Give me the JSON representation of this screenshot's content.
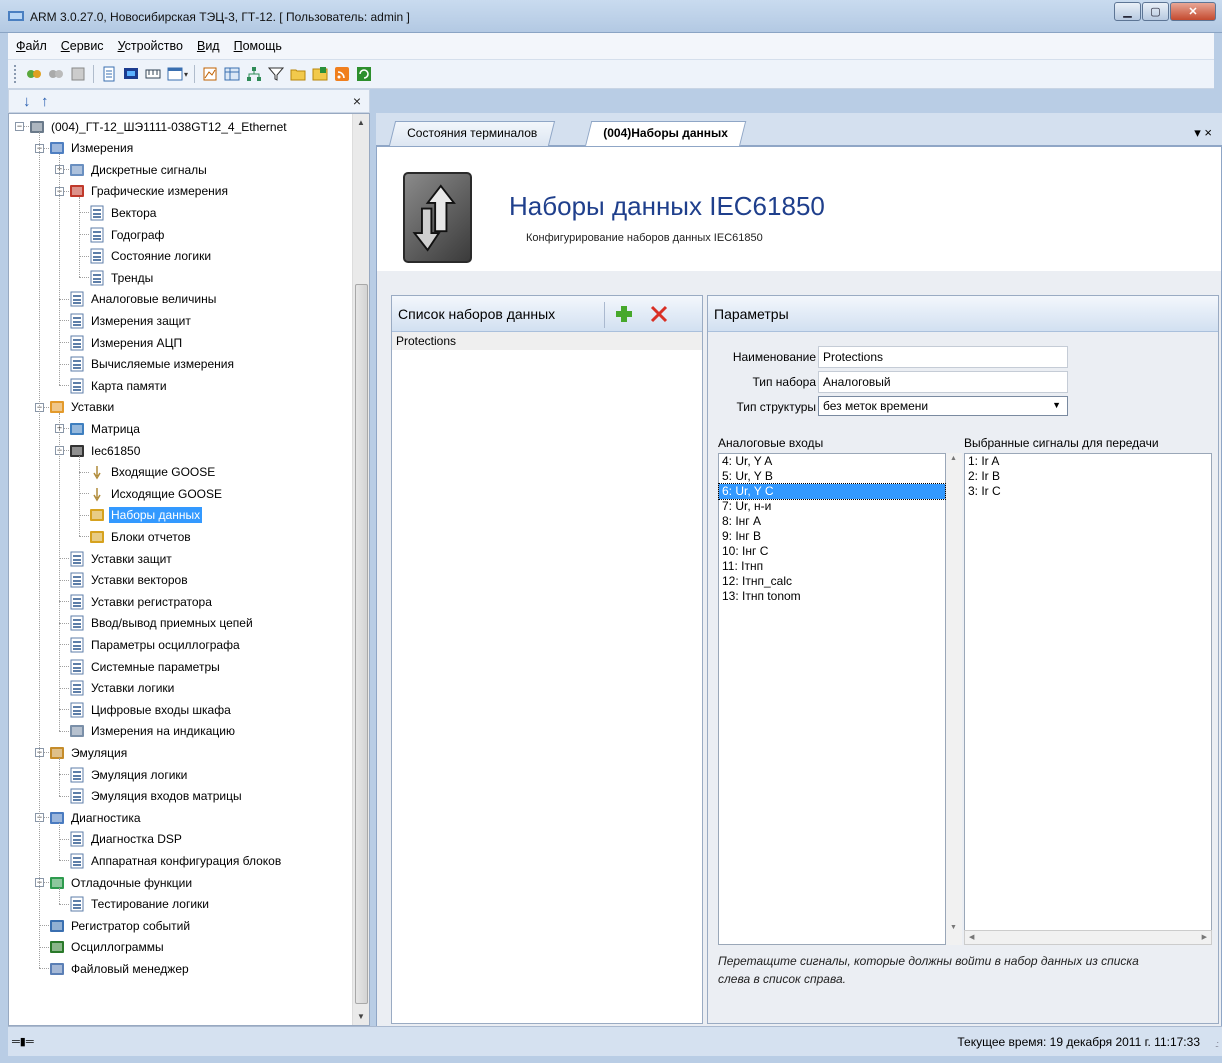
{
  "window": {
    "title": "ARM 3.0.27.0, Новосибирская ТЭЦ-3, ГТ-12. [ Пользователь: admin ]",
    "controls": [
      "minimize",
      "maximize",
      "close"
    ]
  },
  "menu": [
    {
      "first": "Ф",
      "rest": "айл"
    },
    {
      "first": "С",
      "rest": "ервис"
    },
    {
      "first": "У",
      "rest": "стройство"
    },
    {
      "first": "В",
      "rest": "ид"
    },
    {
      "first": "П",
      "rest": "омощь"
    }
  ],
  "toolbar": {
    "icons": [
      "connect-icon",
      "disconnect-icon",
      "terminal-icon",
      "list-icon",
      "monitor-icon",
      "measure-icon",
      "window-icon",
      "chart-icon",
      "table-icon",
      "network-icon",
      "filter-icon",
      "folder-icon",
      "export-icon",
      "rss-icon",
      "refresh-icon"
    ]
  },
  "left_panel": {
    "close_label": "×",
    "scroll_up": "▲",
    "scroll_down": "▼",
    "tree": [
      {
        "label": "(004)_ГТ-12_ШЭ1111-038GT12_4_Ethernet",
        "level": 0,
        "icon": "device-icon",
        "expander": "−"
      },
      {
        "label": "Измерения",
        "level": 1,
        "icon": "measurements-icon",
        "expander": "−"
      },
      {
        "label": "Дискретные сигналы",
        "level": 2,
        "icon": "grid-icon",
        "expander": "+"
      },
      {
        "label": "Графические измерения",
        "level": 2,
        "icon": "graph-icon",
        "expander": "−"
      },
      {
        "label": "Вектора",
        "level": 3,
        "icon": "doc-icon"
      },
      {
        "label": "Годограф",
        "level": 3,
        "icon": "doc-icon"
      },
      {
        "label": "Состояние логики",
        "level": 3,
        "icon": "doc-icon"
      },
      {
        "label": "Тренды",
        "level": 3,
        "icon": "doc-icon"
      },
      {
        "label": "Аналоговые величины",
        "level": 2,
        "icon": "doc-icon"
      },
      {
        "label": "Измерения защит",
        "level": 2,
        "icon": "doc-icon"
      },
      {
        "label": "Измерения АЦП",
        "level": 2,
        "icon": "doc-icon"
      },
      {
        "label": "Вычисляемые измерения",
        "level": 2,
        "icon": "doc-icon"
      },
      {
        "label": "Карта памяти",
        "level": 2,
        "icon": "doc-icon"
      },
      {
        "label": "Уставки",
        "level": 1,
        "icon": "settings-box-icon",
        "expander": "−"
      },
      {
        "label": "Матрица",
        "level": 2,
        "icon": "matrix-icon",
        "expander": "+"
      },
      {
        "label": "Iec61850",
        "level": 2,
        "icon": "iec-icon",
        "expander": "−"
      },
      {
        "label": "Входящие GOOSE",
        "level": 3,
        "icon": "goose-icon"
      },
      {
        "label": "Исходящие GOOSE",
        "level": 3,
        "icon": "goose-icon"
      },
      {
        "label": "Наборы данных",
        "level": 3,
        "icon": "dataset-icon",
        "selected": true
      },
      {
        "label": "Блоки отчетов",
        "level": 3,
        "icon": "dataset-icon"
      },
      {
        "label": "Уставки защит",
        "level": 2,
        "icon": "doc-icon"
      },
      {
        "label": "Уставки векторов",
        "level": 2,
        "icon": "doc-icon"
      },
      {
        "label": "Уставки регистратора",
        "level": 2,
        "icon": "doc-icon"
      },
      {
        "label": "Ввод/вывод приемных цепей",
        "level": 2,
        "icon": "doc-icon"
      },
      {
        "label": "Параметры осциллографа",
        "level": 2,
        "icon": "doc-icon"
      },
      {
        "label": "Системные параметры",
        "level": 2,
        "icon": "doc-icon"
      },
      {
        "label": "Уставки логики",
        "level": 2,
        "icon": "doc-icon"
      },
      {
        "label": "Цифровые входы шкафа",
        "level": 2,
        "icon": "doc-icon"
      },
      {
        "label": "Измерения на индикацию",
        "level": 2,
        "icon": "indication-icon"
      },
      {
        "label": "Эмуляция",
        "level": 1,
        "icon": "emulation-icon",
        "expander": "−"
      },
      {
        "label": "Эмуляция логики",
        "level": 2,
        "icon": "doc-icon"
      },
      {
        "label": "Эмуляция входов матрицы",
        "level": 2,
        "icon": "doc-icon"
      },
      {
        "label": "Диагностика",
        "level": 1,
        "icon": "diagnostics-icon",
        "expander": "−"
      },
      {
        "label": "Диагностка DSP",
        "level": 2,
        "icon": "doc-icon"
      },
      {
        "label": "Аппаратная конфигурация блоков",
        "level": 2,
        "icon": "doc-icon"
      },
      {
        "label": "Отладочные функции",
        "level": 1,
        "icon": "debug-icon",
        "expander": "−"
      },
      {
        "label": "Тестирование логики",
        "level": 2,
        "icon": "doc-icon"
      },
      {
        "label": "Регистратор событий",
        "level": 1,
        "icon": "events-icon"
      },
      {
        "label": "Осциллограммы",
        "level": 1,
        "icon": "oscillogram-icon"
      },
      {
        "label": "Файловый менеджер",
        "level": 1,
        "icon": "filemanager-icon"
      }
    ]
  },
  "tabs": [
    {
      "label": "Состояния терминалов",
      "active": false
    },
    {
      "label": "(004)Наборы данных",
      "active": true
    }
  ],
  "tab_controls": "▾ ×",
  "page": {
    "title": "Наборы данных IEC61850",
    "subtitle": "Конфигурирование наборов данных IEC61850"
  },
  "datasets": {
    "header": "Список наборов данных",
    "items": [
      "Protections"
    ]
  },
  "params": {
    "header": "Параметры",
    "name_label": "Наименование",
    "name_value": "Protections",
    "type_label": "Тип набора",
    "type_value": "Аналоговый",
    "struct_label": "Тип структуры",
    "struct_value": "без меток времени",
    "inputs_label": "Аналоговые входы",
    "inputs": [
      "4: Ur, Y A",
      "5: Ur, Y B",
      "6: Ur, Y C",
      "7: Ur, н-и",
      "8: Iнг A",
      "9: Iнг B",
      "10: Iнг C",
      "11: Iтнп",
      "12: Iтнп_calc",
      "13: Iтнп tonom"
    ],
    "inputs_selected": 2,
    "selected_label": "Выбранные сигналы для передачи",
    "selected": [
      "1: Ir A",
      "2: Ir B",
      "3: Ir C"
    ],
    "hint_line1": "Перетащите сигналы, которые должны войти в набор данных из списка",
    "hint_line2": "слева в список справа."
  },
  "status": {
    "time": "Текущее время: 19 декабря 2011 г. 11:17:33"
  },
  "colors": {
    "selection": "#3399ff",
    "title_blue": "#1f3f8c",
    "add_green": "#46a82b",
    "delete_red": "#d93025"
  }
}
